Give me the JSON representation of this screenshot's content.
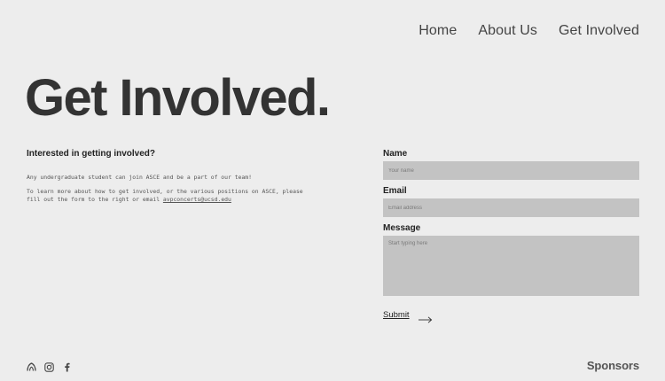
{
  "nav": {
    "items": [
      {
        "label": "Home"
      },
      {
        "label": "About Us"
      },
      {
        "label": "Get Involved"
      }
    ]
  },
  "hero": {
    "title": "Get Involved."
  },
  "intro": {
    "heading": "Interested in getting involved?",
    "paragraph1": "Any undergraduate student can join ASCE and be a part of our team!",
    "paragraph2": "To learn more about how to get involved, or the various positions on ASCE, please fill out the form to the right or email ",
    "email": "avpconcerts@ucsd.edu"
  },
  "form": {
    "name_label": "Name",
    "name_placeholder": "Your name",
    "email_label": "Email",
    "email_placeholder": "Email address",
    "message_label": "Message",
    "message_placeholder": "Start typing here",
    "submit_label": "Submit"
  },
  "footer": {
    "icons": [
      "asce-logo-icon",
      "instagram-icon",
      "facebook-icon"
    ],
    "sponsors_label": "Sponsors"
  },
  "colors": {
    "background": "#ededed",
    "text": "#333333",
    "field": "#c3c3c3"
  }
}
